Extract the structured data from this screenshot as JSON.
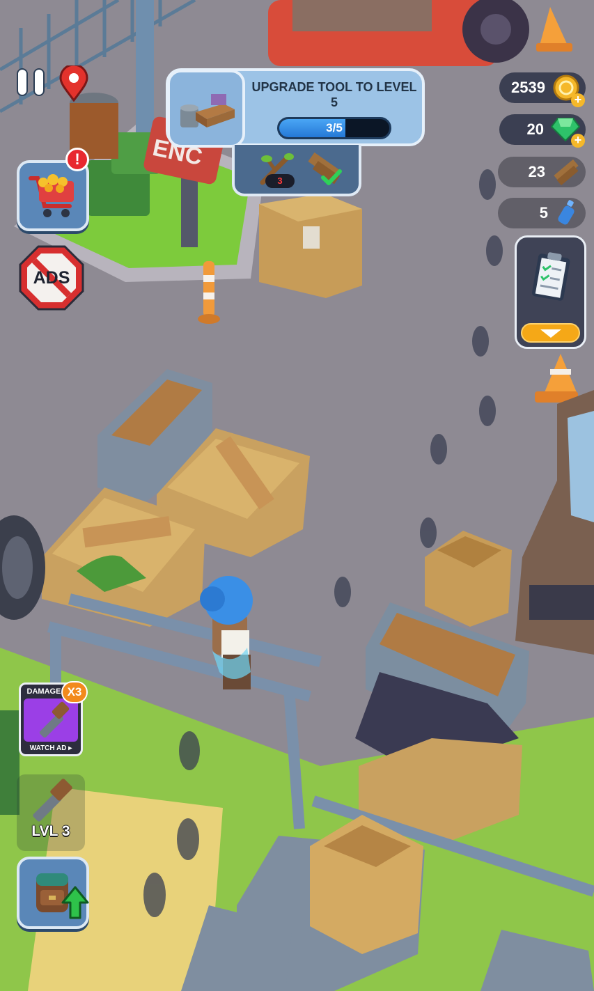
{
  "task": {
    "title": "UPGRADE TOOL TO LEVEL 5",
    "progress_text": "3/5",
    "progress_value": 0.6,
    "requirements": [
      {
        "icon": "branch-icon",
        "count": "3",
        "status": "missing"
      },
      {
        "icon": "plank-icon",
        "status": "complete"
      }
    ]
  },
  "currencies": {
    "coins": "2539",
    "gems": "20",
    "planks": "23",
    "water": "5"
  },
  "buttons": {
    "ads_label": "ADS",
    "damage_label": "DAMAGE",
    "damage_multiplier": "X3",
    "watch_ad_label": "WATCH AD ▸",
    "tool_level_label": "LVL 3"
  },
  "scene_text": {
    "sign_text": "ENC"
  },
  "colors": {
    "accent_blue": "#5a87b8",
    "coin_gold": "#f5b82a",
    "gem_green": "#2ec26a",
    "damage_purple": "#9b3fe6",
    "alert_red": "#e8282f"
  }
}
